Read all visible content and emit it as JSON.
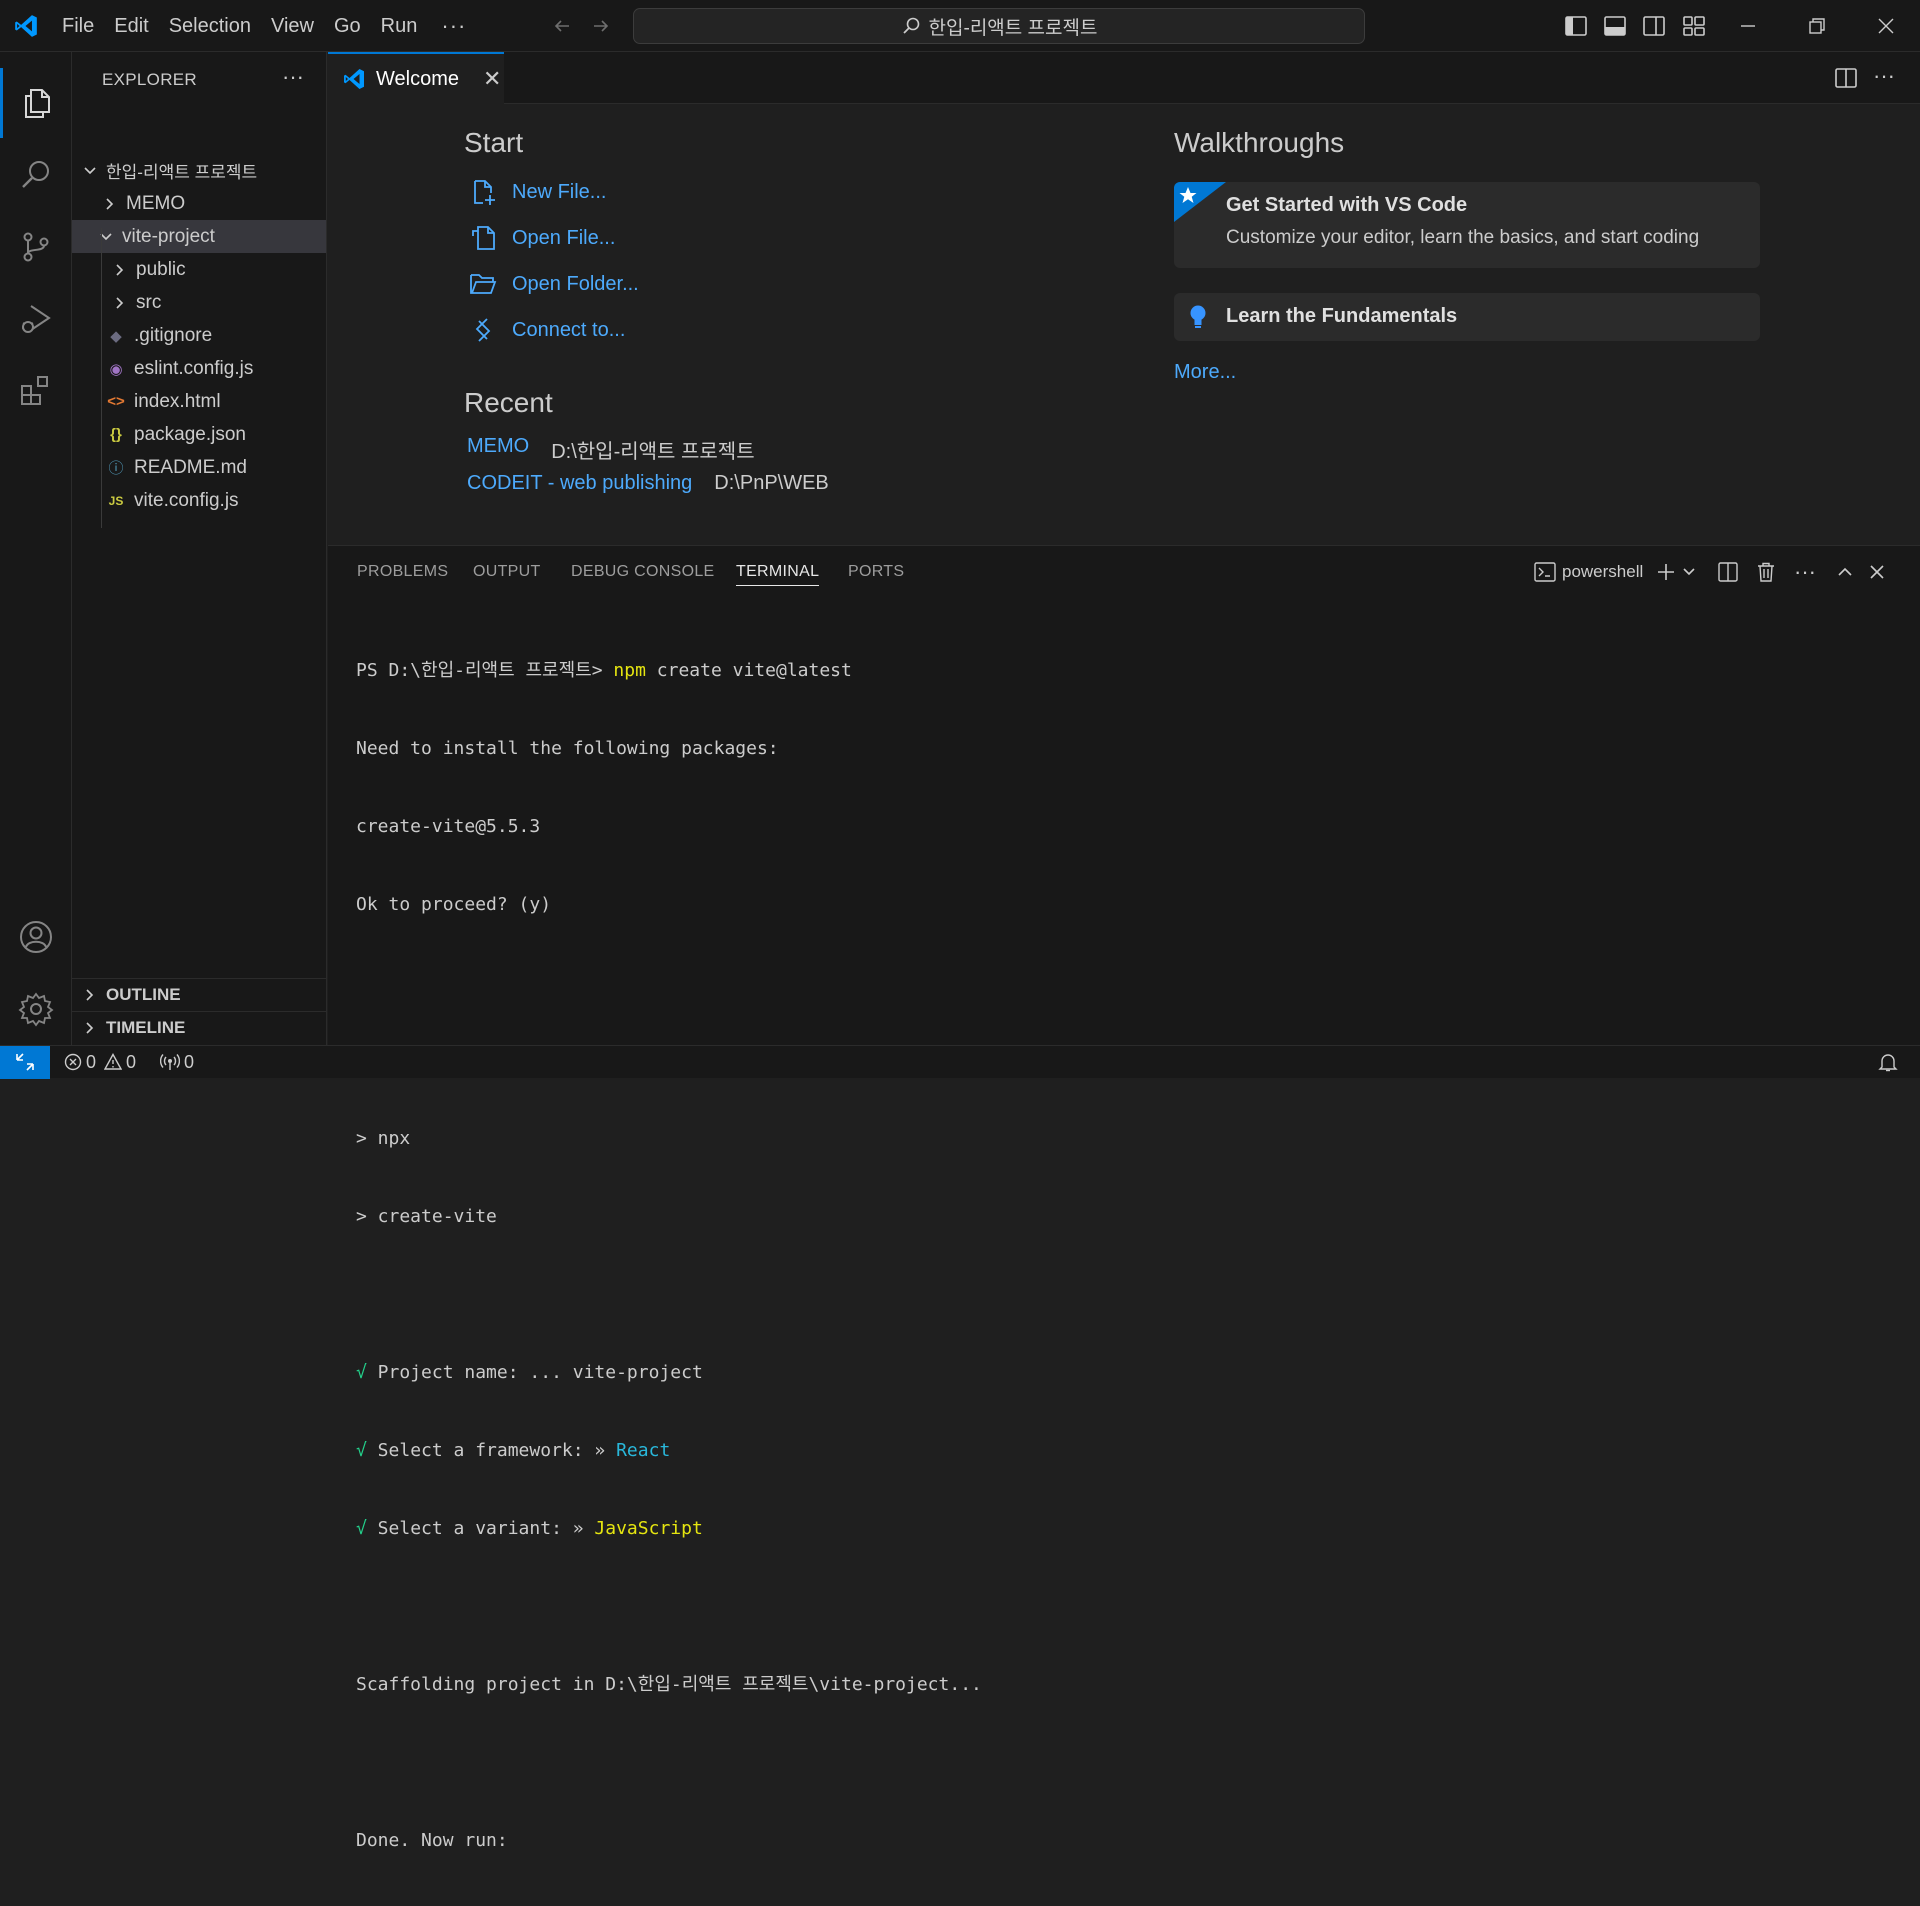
{
  "menu": [
    "File",
    "Edit",
    "Selection",
    "View",
    "Go",
    "Run"
  ],
  "menu_more": "···",
  "search": {
    "text": "한입-리액트 프로젝트"
  },
  "explorer": {
    "title": "EXPLORER",
    "more": "···",
    "root": "한입-리액트 프로젝트",
    "items": [
      {
        "label": "MEMO",
        "type": "folder"
      },
      {
        "label": "vite-project",
        "type": "folder-open"
      },
      {
        "label": "public",
        "type": "folder"
      },
      {
        "label": "src",
        "type": "folder"
      },
      {
        "label": ".gitignore",
        "type": "file",
        "icon": "◆"
      },
      {
        "label": "eslint.config.js",
        "type": "file",
        "icon": "◉"
      },
      {
        "label": "index.html",
        "type": "file",
        "icon": "<>"
      },
      {
        "label": "package.json",
        "type": "file",
        "icon": "{}"
      },
      {
        "label": "README.md",
        "type": "file",
        "icon": "ⓘ"
      },
      {
        "label": "vite.config.js",
        "type": "file",
        "icon": "JS"
      }
    ],
    "outline": "OUTLINE",
    "timeline": "TIMELINE"
  },
  "tab": {
    "label": "Welcome",
    "close": "✕"
  },
  "welcome": {
    "start_title": "Start",
    "start_links": [
      "New File...",
      "Open File...",
      "Open Folder...",
      "Connect to..."
    ],
    "recent_title": "Recent",
    "recent": [
      {
        "name": "MEMO",
        "path": "D:\\한입-리액트 프로젝트"
      },
      {
        "name": "CODEIT - web publishing",
        "path": "D:\\PnP\\WEB"
      }
    ],
    "walkthroughs_title": "Walkthroughs",
    "walkthrough_1_title": "Get Started with VS Code",
    "walkthrough_1_desc": "Customize your editor, learn the basics, and start coding",
    "walkthrough_2_title": "Learn the Fundamentals",
    "more": "More..."
  },
  "panel": {
    "tabs": [
      "PROBLEMS",
      "OUTPUT",
      "DEBUG CONSOLE",
      "TERMINAL",
      "PORTS"
    ],
    "active_tab": "TERMINAL",
    "shell": "powershell",
    "more": "···"
  },
  "terminal": {
    "prompt": "PS D:\\한입-리액트 프로젝트> ",
    "cmd_npm": "npm",
    "cmd_rest": " create vite@latest",
    "line2": "Need to install the following packages:",
    "line3": "create-vite@5.5.3",
    "line4": "Ok to proceed? (y)",
    "line5": "> npx",
    "line6": "> create-vite",
    "check": "√",
    "q1": " Project name: ... vite-project",
    "q2": " Select a framework: » ",
    "q2_val": "React",
    "q3": " Select a variant: » ",
    "q3_val": "JavaScript",
    "line10": "Scaffolding project in D:\\한입-리액트 프로젝트\\vite-project...",
    "line11": "Done. Now run:"
  },
  "status": {
    "errors": "0",
    "warnings": "0",
    "ports": "0"
  },
  "colors": {
    "accent": "#0078d4",
    "link": "#4daafc",
    "editor_bg": "#1f1f1f",
    "chrome_bg": "#181818"
  }
}
